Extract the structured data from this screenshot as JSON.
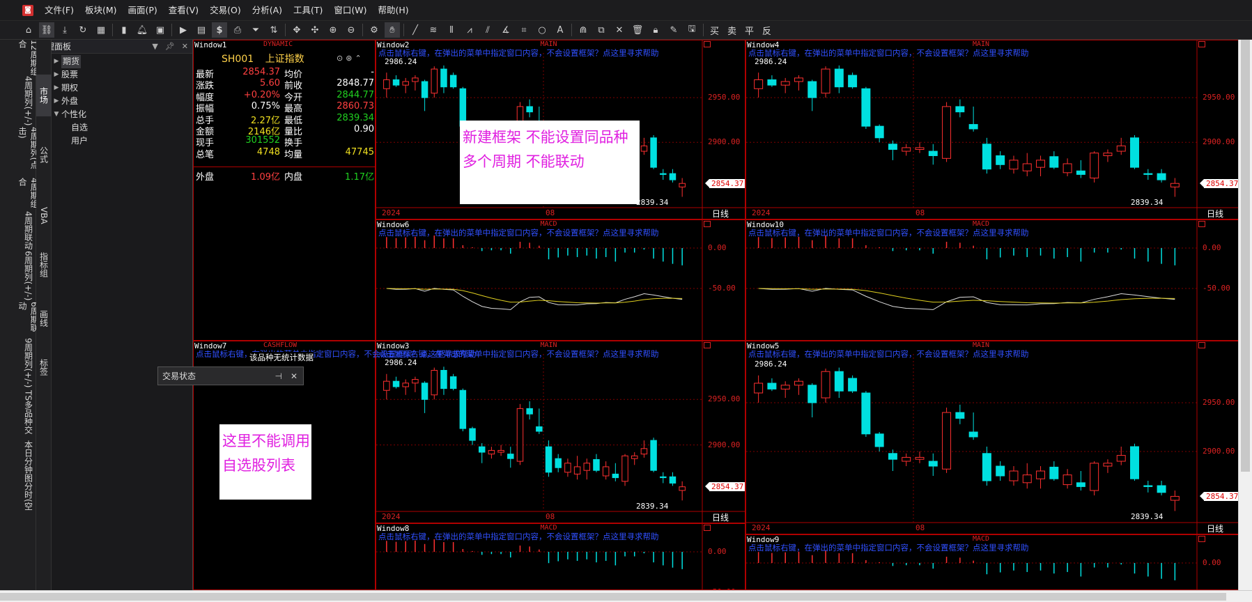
{
  "menu": [
    "文件(F)",
    "板块(M)",
    "画面(P)",
    "查看(V)",
    "交易(O)",
    "分析(A)",
    "工具(T)",
    "窗口(W)",
    "帮助(H)"
  ],
  "toolbar": {
    "trade_labels": [
      "买",
      "卖",
      "平",
      "反"
    ]
  },
  "left_tabs": [
    "12周期组合",
    "4周期列(+/-)",
    "4周期列(点击)",
    "4周期组合",
    "4周期联动",
    "6周期列(+/-)",
    "6周期联动",
    "9周期列(+/-)",
    "TS多品种交",
    "本日分钟图",
    "分时(空"
  ],
  "sub_tabs": [
    "市场",
    "公式",
    "VBA",
    "指标组",
    "画线",
    "标签"
  ],
  "panel": {
    "title": "管理面板",
    "tree": [
      {
        "label": "期货",
        "level": 0,
        "arrow": "▶",
        "selected": true
      },
      {
        "label": "股票",
        "level": 0,
        "arrow": "▶"
      },
      {
        "label": "期权",
        "level": 0,
        "arrow": "▶"
      },
      {
        "label": "外盘",
        "level": 0,
        "arrow": "▶"
      },
      {
        "label": "个性化",
        "level": 0,
        "arrow": "▼"
      },
      {
        "label": "自选",
        "level": 1,
        "arrow": ""
      },
      {
        "label": "用户",
        "level": 1,
        "arrow": ""
      }
    ]
  },
  "hint": "点击鼠标右键，在弹出的菜单中指定窗口内容，不会设置框架？点这里寻求帮助",
  "quote": {
    "window": "Window1",
    "type": "DYNAMIC",
    "code": "SH001",
    "name": "上证指数",
    "rows": [
      {
        "k1": "最新",
        "v1": "2854.37",
        "c1": "vr",
        "k2": "均价",
        "v2": "-",
        "c2": "vw"
      },
      {
        "k1": "涨跌",
        "v1": "5.60",
        "c1": "vr",
        "k2": "前收",
        "v2": "2848.77",
        "c2": "vw"
      },
      {
        "k1": "幅度",
        "v1": "+0.20%",
        "c1": "vr",
        "k2": "今开",
        "v2": "2844.77",
        "c2": "vg"
      },
      {
        "k1": "振幅",
        "v1": "0.75%",
        "c1": "vw",
        "k2": "最高",
        "v2": "2860.73",
        "c2": "vr"
      },
      {
        "k1": "总手",
        "v1": "2.27亿",
        "c1": "vy",
        "k2": "最低",
        "v2": "2839.34",
        "c2": "vg"
      },
      {
        "k1": "金额",
        "v1": "2146亿",
        "c1": "vy",
        "k2": "量比",
        "v2": "0.90",
        "c2": "vw"
      },
      {
        "k1": "现手",
        "v1": "301552",
        "c1": "vg",
        "k2": "换手",
        "v2": "",
        "c2": "vw"
      },
      {
        "k1": "总笔",
        "v1": "4748",
        "c1": "vy",
        "k2": "均量",
        "v2": "47745",
        "c2": "vy"
      }
    ],
    "outer": {
      "k1": "外盘",
      "v1": "1.09亿",
      "k2": "内盘",
      "v2": "1.17亿"
    }
  },
  "cashflow": {
    "window": "Window7",
    "type": "CASHFLOW",
    "msg": "该品种无统计数据"
  },
  "trade_popup": {
    "title": "交易状态"
  },
  "notes": {
    "a": {
      "line1": "新建框架  不能设置同品种",
      "line2": "多个周期  不能联动"
    },
    "b": {
      "line1": "这里不能调用",
      "line2": "自选股列表"
    }
  },
  "chart_labels": {
    "main": "MAIN",
    "macd": "MACD",
    "period": "日线",
    "year": "2024",
    "month": "08",
    "high": "2986.24",
    "low": "2839.34",
    "last": "2854.37",
    "price_ticks": [
      "2950.00",
      "2900.00"
    ],
    "macd_ticks": [
      "0.00",
      "-50.00"
    ]
  },
  "windows": {
    "w2": "Window2",
    "w3": "Window3",
    "w4": "Window4",
    "w5": "Window5",
    "w6": "Window6",
    "w8": "Window8",
    "w9": "Window9",
    "w10": "Window10"
  },
  "chart_data": {
    "type": "candlestick",
    "ylim": [
      2830,
      3000
    ],
    "high_label": 2986.24,
    "low_label": 2839.34,
    "last": 2854.37,
    "candles": [
      {
        "o": 2960,
        "h": 2978,
        "l": 2950,
        "c": 2970
      },
      {
        "o": 2970,
        "h": 2975,
        "l": 2962,
        "c": 2964
      },
      {
        "o": 2964,
        "h": 2972,
        "l": 2955,
        "c": 2968
      },
      {
        "o": 2968,
        "h": 2975,
        "l": 2958,
        "c": 2972
      },
      {
        "o": 2968,
        "h": 2970,
        "l": 2935,
        "c": 2950
      },
      {
        "o": 2955,
        "h": 2985,
        "l": 2950,
        "c": 2982
      },
      {
        "o": 2982,
        "h": 2986,
        "l": 2955,
        "c": 2962
      },
      {
        "o": 2975,
        "h": 2978,
        "l": 2960,
        "c": 2962
      },
      {
        "o": 2960,
        "h": 2962,
        "l": 2915,
        "c": 2918
      },
      {
        "o": 2918,
        "h": 2920,
        "l": 2900,
        "c": 2905
      },
      {
        "o": 2898,
        "h": 2902,
        "l": 2880,
        "c": 2892
      },
      {
        "o": 2890,
        "h": 2898,
        "l": 2885,
        "c": 2894
      },
      {
        "o": 2892,
        "h": 2900,
        "l": 2888,
        "c": 2894
      },
      {
        "o": 2890,
        "h": 2898,
        "l": 2875,
        "c": 2885
      },
      {
        "o": 2882,
        "h": 2945,
        "l": 2878,
        "c": 2940
      },
      {
        "o": 2940,
        "h": 2948,
        "l": 2928,
        "c": 2934
      },
      {
        "o": 2920,
        "h": 2940,
        "l": 2912,
        "c": 2915
      },
      {
        "o": 2898,
        "h": 2905,
        "l": 2865,
        "c": 2870
      },
      {
        "o": 2885,
        "h": 2890,
        "l": 2870,
        "c": 2875
      },
      {
        "o": 2870,
        "h": 2885,
        "l": 2865,
        "c": 2880
      },
      {
        "o": 2868,
        "h": 2888,
        "l": 2862,
        "c": 2876
      },
      {
        "o": 2872,
        "h": 2885,
        "l": 2862,
        "c": 2880
      },
      {
        "o": 2884,
        "h": 2890,
        "l": 2870,
        "c": 2872
      },
      {
        "o": 2866,
        "h": 2882,
        "l": 2862,
        "c": 2876
      },
      {
        "o": 2868,
        "h": 2880,
        "l": 2860,
        "c": 2864
      },
      {
        "o": 2860,
        "h": 2890,
        "l": 2855,
        "c": 2888
      },
      {
        "o": 2885,
        "h": 2892,
        "l": 2878,
        "c": 2888
      },
      {
        "o": 2890,
        "h": 2905,
        "l": 2886,
        "c": 2896
      },
      {
        "o": 2905,
        "h": 2908,
        "l": 2870,
        "c": 2872
      },
      {
        "o": 2865,
        "h": 2870,
        "l": 2858,
        "c": 2864
      },
      {
        "o": 2865,
        "h": 2870,
        "l": 2855,
        "c": 2858
      },
      {
        "o": 2850,
        "h": 2860,
        "l": 2839,
        "c": 2854
      }
    ]
  }
}
